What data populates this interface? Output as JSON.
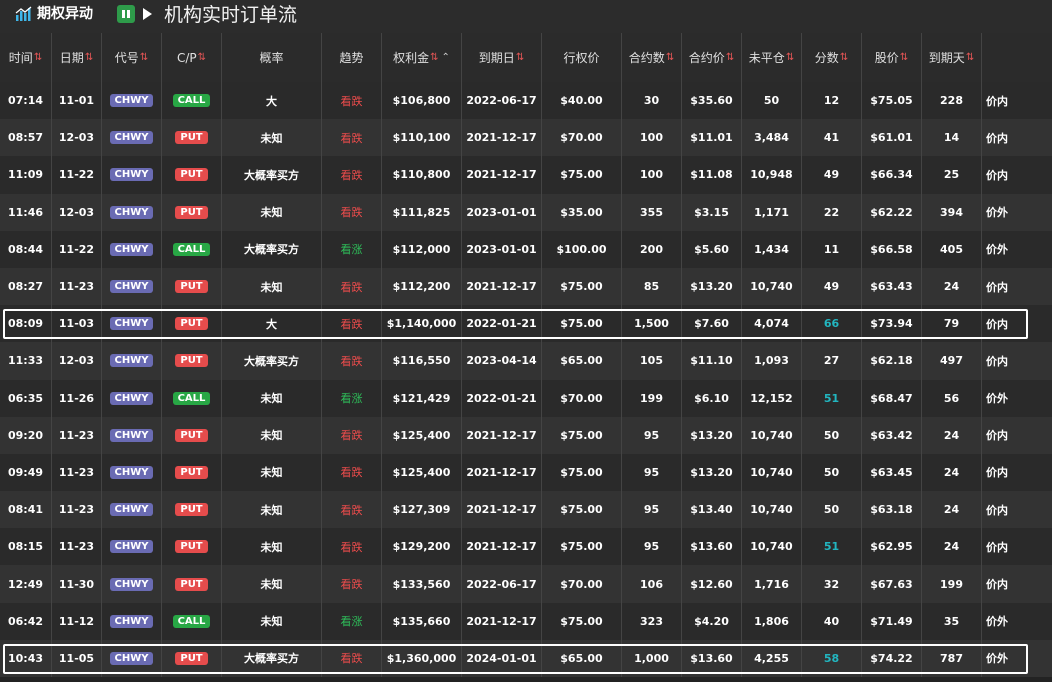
{
  "app": {
    "logo_text": "期权异动",
    "title": "机构实时订单流"
  },
  "colors": {
    "call": "#28a745",
    "put": "#e54c4c",
    "ticker": "#6a6bb3",
    "trend_down": "#ee4c4c",
    "trend_up": "#2ebd59",
    "score_highlight": "#22b6c0"
  },
  "columns": [
    {
      "key": "time",
      "label": "时间",
      "sort": true
    },
    {
      "key": "date",
      "label": "日期",
      "sort": true
    },
    {
      "key": "symbol",
      "label": "代号",
      "sort": true
    },
    {
      "key": "cp",
      "label": "C/P",
      "sort": true
    },
    {
      "key": "prob",
      "label": "概率",
      "sort": false
    },
    {
      "key": "trend",
      "label": "趋势",
      "sort": false
    },
    {
      "key": "premium",
      "label": "权利金",
      "sort": true,
      "active": true
    },
    {
      "key": "expiry",
      "label": "到期日",
      "sort": true
    },
    {
      "key": "strike",
      "label": "行权价",
      "sort": false
    },
    {
      "key": "contracts",
      "label": "合约数",
      "sort": true
    },
    {
      "key": "price",
      "label": "合约价",
      "sort": true
    },
    {
      "key": "oi",
      "label": "未平仓",
      "sort": true
    },
    {
      "key": "score",
      "label": "分数",
      "sort": true
    },
    {
      "key": "stock",
      "label": "股价",
      "sort": true
    },
    {
      "key": "dte",
      "label": "到期天",
      "sort": true
    },
    {
      "key": "moneyness",
      "label": "",
      "sort": false
    }
  ],
  "rows": [
    {
      "time": "07:14",
      "date": "11-01",
      "symbol": "CHWY",
      "cp": "CALL",
      "prob": "大",
      "trend": "看跌",
      "premium": "$106,800",
      "expiry": "2022-06-17",
      "strike": "$40.00",
      "contracts": "30",
      "price": "$35.60",
      "oi": "50",
      "score": "12",
      "stock": "$75.05",
      "dte": "228",
      "moneyness": "价内",
      "highlight": false
    },
    {
      "time": "08:57",
      "date": "12-03",
      "symbol": "CHWY",
      "cp": "PUT",
      "prob": "未知",
      "trend": "看跌",
      "premium": "$110,100",
      "expiry": "2021-12-17",
      "strike": "$70.00",
      "contracts": "100",
      "price": "$11.01",
      "oi": "3,484",
      "score": "41",
      "stock": "$61.01",
      "dte": "14",
      "moneyness": "价内",
      "highlight": false
    },
    {
      "time": "11:09",
      "date": "11-22",
      "symbol": "CHWY",
      "cp": "PUT",
      "prob": "大概率买方",
      "trend": "看跌",
      "premium": "$110,800",
      "expiry": "2021-12-17",
      "strike": "$75.00",
      "contracts": "100",
      "price": "$11.08",
      "oi": "10,948",
      "score": "49",
      "stock": "$66.34",
      "dte": "25",
      "moneyness": "价内",
      "highlight": false
    },
    {
      "time": "11:46",
      "date": "12-03",
      "symbol": "CHWY",
      "cp": "PUT",
      "prob": "未知",
      "trend": "看跌",
      "premium": "$111,825",
      "expiry": "2023-01-01",
      "strike": "$35.00",
      "contracts": "355",
      "price": "$3.15",
      "oi": "1,171",
      "score": "22",
      "stock": "$62.22",
      "dte": "394",
      "moneyness": "价外",
      "highlight": false
    },
    {
      "time": "08:44",
      "date": "11-22",
      "symbol": "CHWY",
      "cp": "CALL",
      "prob": "大概率买方",
      "trend": "看涨",
      "premium": "$112,000",
      "expiry": "2023-01-01",
      "strike": "$100.00",
      "contracts": "200",
      "price": "$5.60",
      "oi": "1,434",
      "score": "11",
      "stock": "$66.58",
      "dte": "405",
      "moneyness": "价外",
      "highlight": false
    },
    {
      "time": "08:27",
      "date": "11-23",
      "symbol": "CHWY",
      "cp": "PUT",
      "prob": "未知",
      "trend": "看跌",
      "premium": "$112,200",
      "expiry": "2021-12-17",
      "strike": "$75.00",
      "contracts": "85",
      "price": "$13.20",
      "oi": "10,740",
      "score": "49",
      "stock": "$63.43",
      "dte": "24",
      "moneyness": "价内",
      "highlight": false
    },
    {
      "time": "08:09",
      "date": "11-03",
      "symbol": "CHWY",
      "cp": "PUT",
      "prob": "大",
      "trend": "看跌",
      "premium": "$1,140,000",
      "expiry": "2022-01-21",
      "strike": "$75.00",
      "contracts": "1,500",
      "price": "$7.60",
      "oi": "4,074",
      "score": "66",
      "stock": "$73.94",
      "dte": "79",
      "moneyness": "价内",
      "highlight": true
    },
    {
      "time": "11:33",
      "date": "12-03",
      "symbol": "CHWY",
      "cp": "PUT",
      "prob": "大概率买方",
      "trend": "看跌",
      "premium": "$116,550",
      "expiry": "2023-04-14",
      "strike": "$65.00",
      "contracts": "105",
      "price": "$11.10",
      "oi": "1,093",
      "score": "27",
      "stock": "$62.18",
      "dte": "497",
      "moneyness": "价内",
      "highlight": false
    },
    {
      "time": "06:35",
      "date": "11-26",
      "symbol": "CHWY",
      "cp": "CALL",
      "prob": "未知",
      "trend": "看涨",
      "premium": "$121,429",
      "expiry": "2022-01-21",
      "strike": "$70.00",
      "contracts": "199",
      "price": "$6.10",
      "oi": "12,152",
      "score": "51",
      "stock": "$68.47",
      "dte": "56",
      "moneyness": "价外",
      "highlight": false
    },
    {
      "time": "09:20",
      "date": "11-23",
      "symbol": "CHWY",
      "cp": "PUT",
      "prob": "未知",
      "trend": "看跌",
      "premium": "$125,400",
      "expiry": "2021-12-17",
      "strike": "$75.00",
      "contracts": "95",
      "price": "$13.20",
      "oi": "10,740",
      "score": "50",
      "stock": "$63.42",
      "dte": "24",
      "moneyness": "价内",
      "highlight": false
    },
    {
      "time": "09:49",
      "date": "11-23",
      "symbol": "CHWY",
      "cp": "PUT",
      "prob": "未知",
      "trend": "看跌",
      "premium": "$125,400",
      "expiry": "2021-12-17",
      "strike": "$75.00",
      "contracts": "95",
      "price": "$13.20",
      "oi": "10,740",
      "score": "50",
      "stock": "$63.45",
      "dte": "24",
      "moneyness": "价内",
      "highlight": false
    },
    {
      "time": "08:41",
      "date": "11-23",
      "symbol": "CHWY",
      "cp": "PUT",
      "prob": "未知",
      "trend": "看跌",
      "premium": "$127,309",
      "expiry": "2021-12-17",
      "strike": "$75.00",
      "contracts": "95",
      "price": "$13.40",
      "oi": "10,740",
      "score": "50",
      "stock": "$63.18",
      "dte": "24",
      "moneyness": "价内",
      "highlight": false
    },
    {
      "time": "08:15",
      "date": "11-23",
      "symbol": "CHWY",
      "cp": "PUT",
      "prob": "未知",
      "trend": "看跌",
      "premium": "$129,200",
      "expiry": "2021-12-17",
      "strike": "$75.00",
      "contracts": "95",
      "price": "$13.60",
      "oi": "10,740",
      "score": "51",
      "stock": "$62.95",
      "dte": "24",
      "moneyness": "价内",
      "highlight": false
    },
    {
      "time": "12:49",
      "date": "11-30",
      "symbol": "CHWY",
      "cp": "PUT",
      "prob": "未知",
      "trend": "看跌",
      "premium": "$133,560",
      "expiry": "2022-06-17",
      "strike": "$70.00",
      "contracts": "106",
      "price": "$12.60",
      "oi": "1,716",
      "score": "32",
      "stock": "$67.63",
      "dte": "199",
      "moneyness": "价内",
      "highlight": false
    },
    {
      "time": "06:42",
      "date": "11-12",
      "symbol": "CHWY",
      "cp": "CALL",
      "prob": "未知",
      "trend": "看涨",
      "premium": "$135,660",
      "expiry": "2021-12-17",
      "strike": "$75.00",
      "contracts": "323",
      "price": "$4.20",
      "oi": "1,806",
      "score": "40",
      "stock": "$71.49",
      "dte": "35",
      "moneyness": "价外",
      "highlight": false
    },
    {
      "time": "10:43",
      "date": "11-05",
      "symbol": "CHWY",
      "cp": "PUT",
      "prob": "大概率买方",
      "trend": "看跌",
      "premium": "$1,360,000",
      "expiry": "2024-01-01",
      "strike": "$65.00",
      "contracts": "1,000",
      "price": "$13.60",
      "oi": "4,255",
      "score": "58",
      "stock": "$74.22",
      "dte": "787",
      "moneyness": "价外",
      "highlight": true
    }
  ]
}
